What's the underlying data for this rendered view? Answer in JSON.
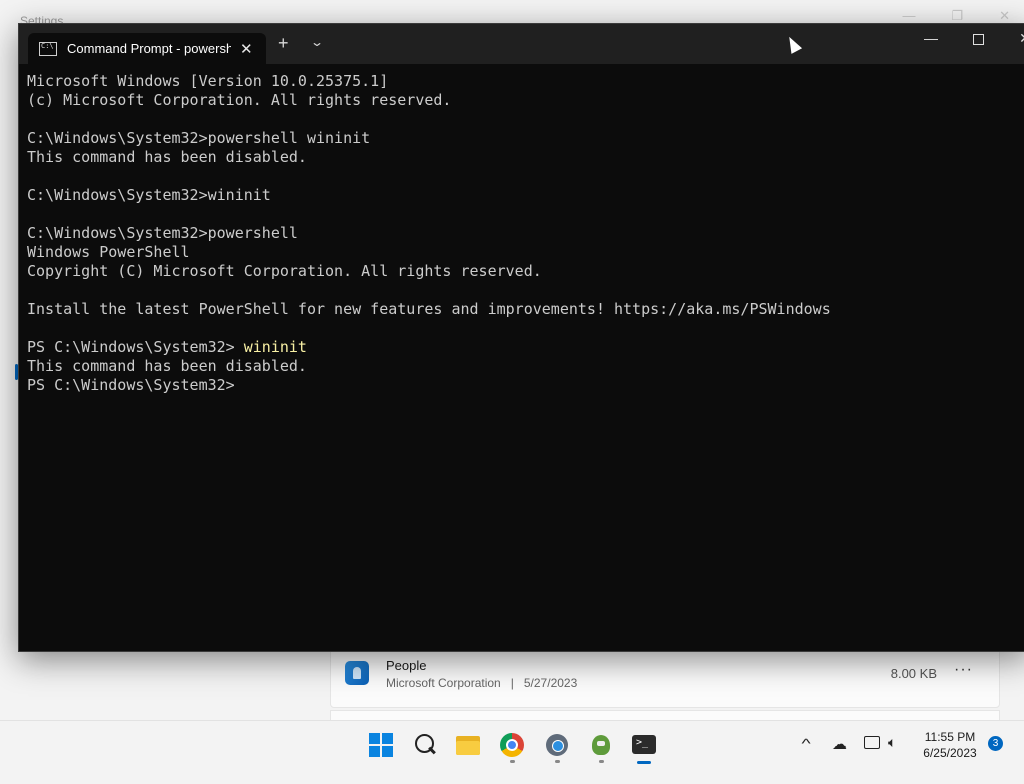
{
  "background_window": {
    "title": "Settings",
    "app_entry": {
      "name": "People",
      "publisher": "Microsoft Corporation",
      "separator": "|",
      "date": "5/27/2023",
      "size": "8.00 KB",
      "more": "···"
    }
  },
  "terminal": {
    "tab_title": "Command Prompt - powershell",
    "tab_close": "✕",
    "new_tab": "+",
    "dropdown": "⌄",
    "min": "—",
    "close": "✕",
    "lines": [
      {
        "text": "Microsoft Windows [Version 10.0.25375.1]"
      },
      {
        "text": "(c) Microsoft Corporation. All rights reserved."
      },
      {
        "text": ""
      },
      {
        "text": "C:\\Windows\\System32>powershell wininit"
      },
      {
        "text": "This command has been disabled."
      },
      {
        "text": ""
      },
      {
        "text": "C:\\Windows\\System32>wininit"
      },
      {
        "text": ""
      },
      {
        "text": "C:\\Windows\\System32>powershell"
      },
      {
        "text": "Windows PowerShell"
      },
      {
        "text": "Copyright (C) Microsoft Corporation. All rights reserved."
      },
      {
        "text": ""
      },
      {
        "text": "Install the latest PowerShell for new features and improvements! https://aka.ms/PSWindows"
      },
      {
        "text": ""
      },
      {
        "prompt": "PS C:\\Windows\\System32> ",
        "cmd": "wininit"
      },
      {
        "text": "This command has been disabled."
      },
      {
        "text": "PS C:\\Windows\\System32>"
      }
    ],
    "command_highlight_color": "#f9f1a5"
  },
  "taskbar": {
    "apps": [
      "start-icon",
      "search-icon",
      "file-explorer-icon",
      "chrome-icon",
      "settings-icon",
      "app-icon",
      "terminal-icon"
    ],
    "clock_time": "11:55 PM",
    "clock_date": "6/25/2023",
    "notification_count": "3",
    "tray_chevron": "^"
  },
  "colors": {
    "accent": "#0067c0",
    "terminal_bg": "#0c0c0c",
    "terminal_text": "#cccccc"
  }
}
